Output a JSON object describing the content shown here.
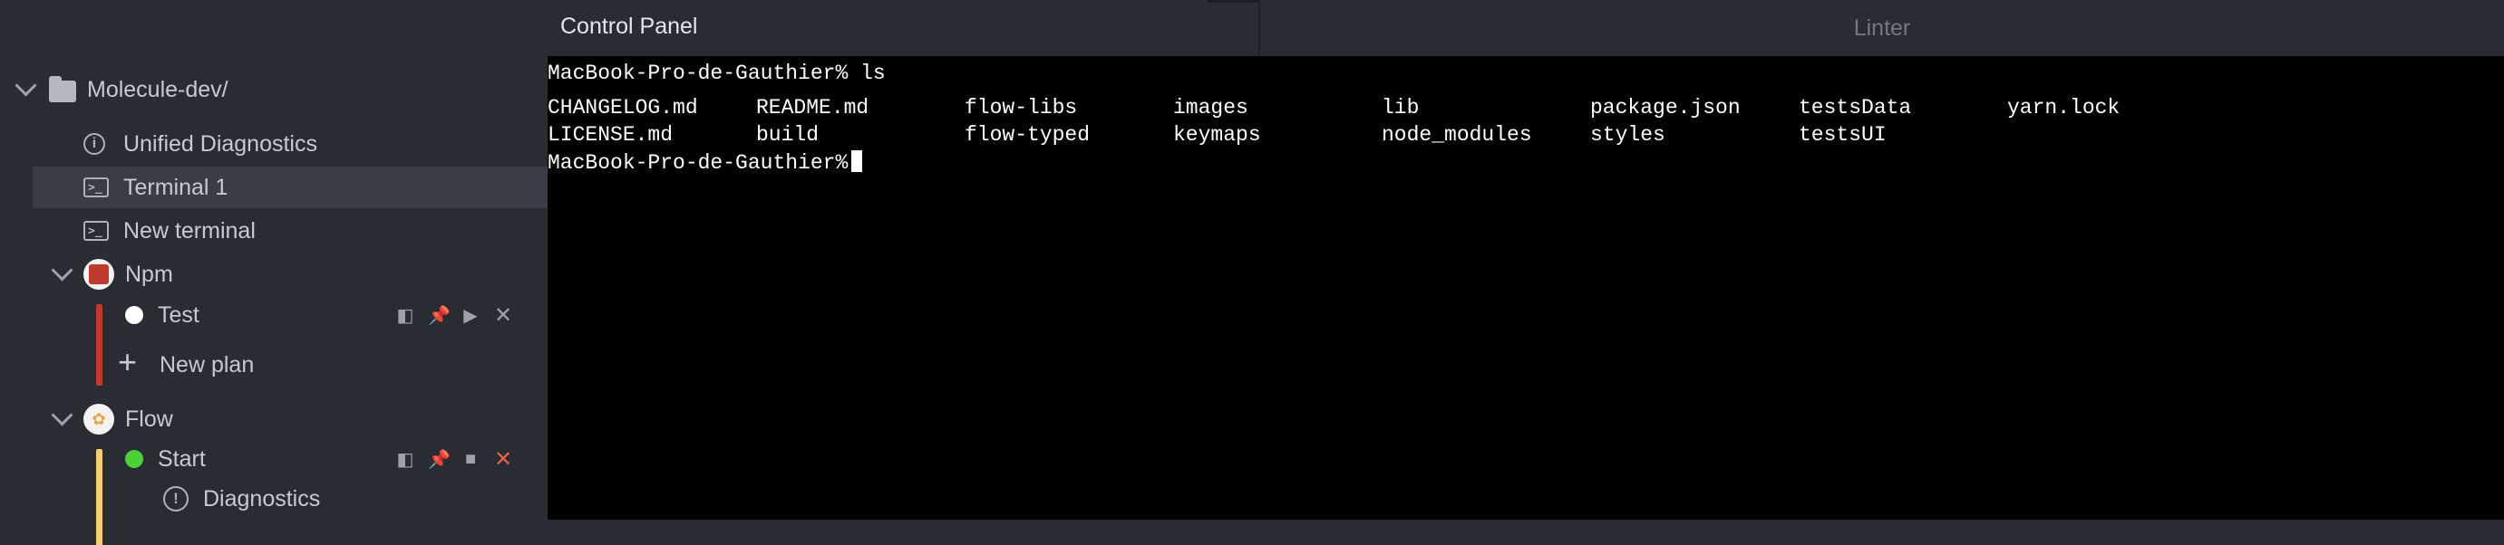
{
  "sidebar": {
    "project": {
      "label": "Molecule-dev/",
      "icon": "folder-icon"
    },
    "unified_diagnostics": {
      "label": "Unified Diagnostics",
      "icon": "info-icon"
    },
    "terminal_1": {
      "label": "Terminal 1",
      "icon": "terminal-icon"
    },
    "new_terminal": {
      "label": "New terminal",
      "icon": "terminal-icon"
    },
    "npm": {
      "label": "Npm",
      "icon": "npm-icon",
      "bar_color": "#c0392b",
      "test": {
        "label": "Test",
        "status_color": "#ffffff"
      },
      "new_plan": {
        "label": "New plan",
        "plus": "+"
      }
    },
    "flow": {
      "label": "Flow",
      "icon": "flow-icon",
      "bar_color": "#f3cf6c",
      "start": {
        "label": "Start",
        "status_color": "#4cd137"
      },
      "diagnostics": {
        "label": "Diagnostics",
        "icon": "exclamation-icon"
      }
    },
    "action_glyphs": {
      "split": "◧",
      "pin": "✎",
      "run": "▶",
      "stop": "■",
      "close": "✕"
    }
  },
  "tabs": {
    "control_panel": "Control Panel",
    "linter": "Linter"
  },
  "terminal": {
    "prompt": "MacBook-Pro-de-Gauthier%",
    "command": "ls",
    "listing": [
      [
        "CHANGELOG.md",
        "README.md",
        "flow-libs",
        "images",
        "lib",
        "package.json",
        "testsData",
        "yarn.lock"
      ],
      [
        "LICENSE.md",
        "build",
        "flow-typed",
        "keymaps",
        "node_modules",
        "styles",
        "testsUI",
        ""
      ]
    ]
  },
  "colors": {
    "accent_green": "#7ec96b",
    "accent_red": "#e8604c",
    "terminal_bg": "#000000",
    "sidebar_bg": "#2a2c33"
  }
}
